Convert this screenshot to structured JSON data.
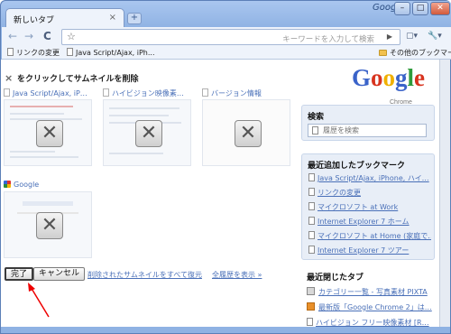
{
  "window": {
    "tab_title": "新しいタブ",
    "tab_close": "×",
    "new_tab": "+",
    "brand": "Google",
    "minimize": "–",
    "maximize": "□",
    "close": "✕"
  },
  "toolbar": {
    "back": "←",
    "forward": "→",
    "reload": "C",
    "star": "☆",
    "omnibox_placeholder": "キーワードを入力して検索",
    "go": "▶",
    "page_menu": "▢▾",
    "tools_menu": "🔧▾"
  },
  "bookmarks_bar": {
    "items": [
      "リンクの変更",
      "Java Script/Ajax, iPh..."
    ],
    "other": "その他のブックマーク"
  },
  "thumbnails": {
    "header": "をクリックしてサムネイルを削除",
    "header_icon": "×",
    "items": [
      {
        "title": "Java Script/Ajax, iP…"
      },
      {
        "title": "ハイビジョン映像素…"
      },
      {
        "title": "バージョン情報"
      },
      {
        "title": "Google"
      }
    ],
    "remove_glyph": "✕"
  },
  "actions": {
    "done": "完了",
    "cancel": "キャンセル",
    "restore_all": "削除されたサムネイルをすべて復元",
    "show_history": "全履歴を表示 »"
  },
  "logo": {
    "letters": [
      "G",
      "o",
      "o",
      "g",
      "l",
      "e"
    ],
    "subtitle": "Chrome",
    "colors": [
      "#3a63c9",
      "#d8341f",
      "#f0b000",
      "#3a63c9",
      "#2f9c3c",
      "#d8341f"
    ]
  },
  "search_panel": {
    "title": "検索",
    "placeholder": "履歴を検索"
  },
  "bookmarks_panel": {
    "title": "最近追加したブックマーク",
    "items": [
      "Java Script/Ajax, iPhone, ハイ…",
      "リンクの変更",
      "マイクロソフト at Work",
      "Internet Explorer 7 ホーム",
      "マイクロソフト at Home (家庭で…",
      "Internet Explorer 7 ツアー"
    ]
  },
  "recent_panel": {
    "title": "最近閉じたタブ",
    "items": [
      "カテゴリー一覧 - 写真素材 PIXTA",
      "最新版「Google Chrome 2」は…",
      "ハイビジョン フリー映像素材 [R…"
    ]
  }
}
